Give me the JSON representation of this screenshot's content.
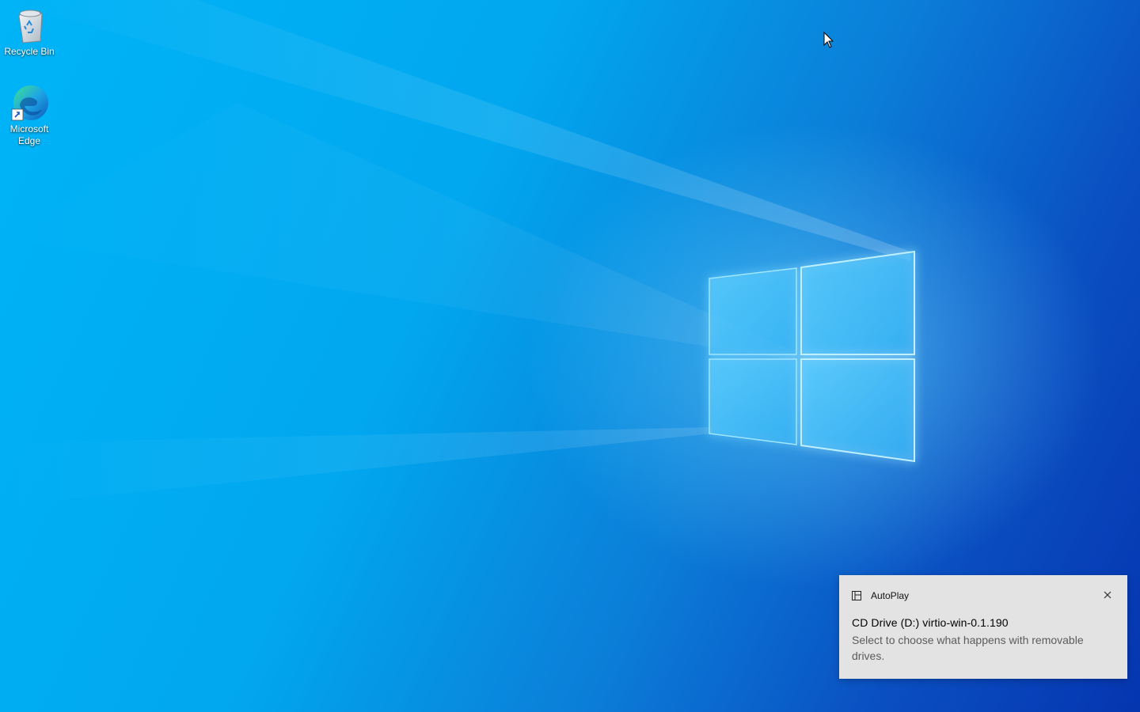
{
  "desktop": {
    "icons": [
      {
        "label": "Recycle Bin",
        "icon": "recycle-bin-icon"
      },
      {
        "label": "Microsoft Edge",
        "icon": "edge-icon"
      }
    ],
    "wallpaper": "windows-10-hero",
    "colors": {
      "wallpaper_light": "#00b4f7",
      "wallpaper_dark": "#0535b0"
    }
  },
  "toast": {
    "app_name": "AutoPlay",
    "app_icon": "autoplay-icon",
    "title": "CD Drive (D:) virtio-win-0.1.190",
    "body": "Select to choose what happens with removable drives.",
    "close_icon": "close-icon",
    "background": "#e3e3e3"
  }
}
